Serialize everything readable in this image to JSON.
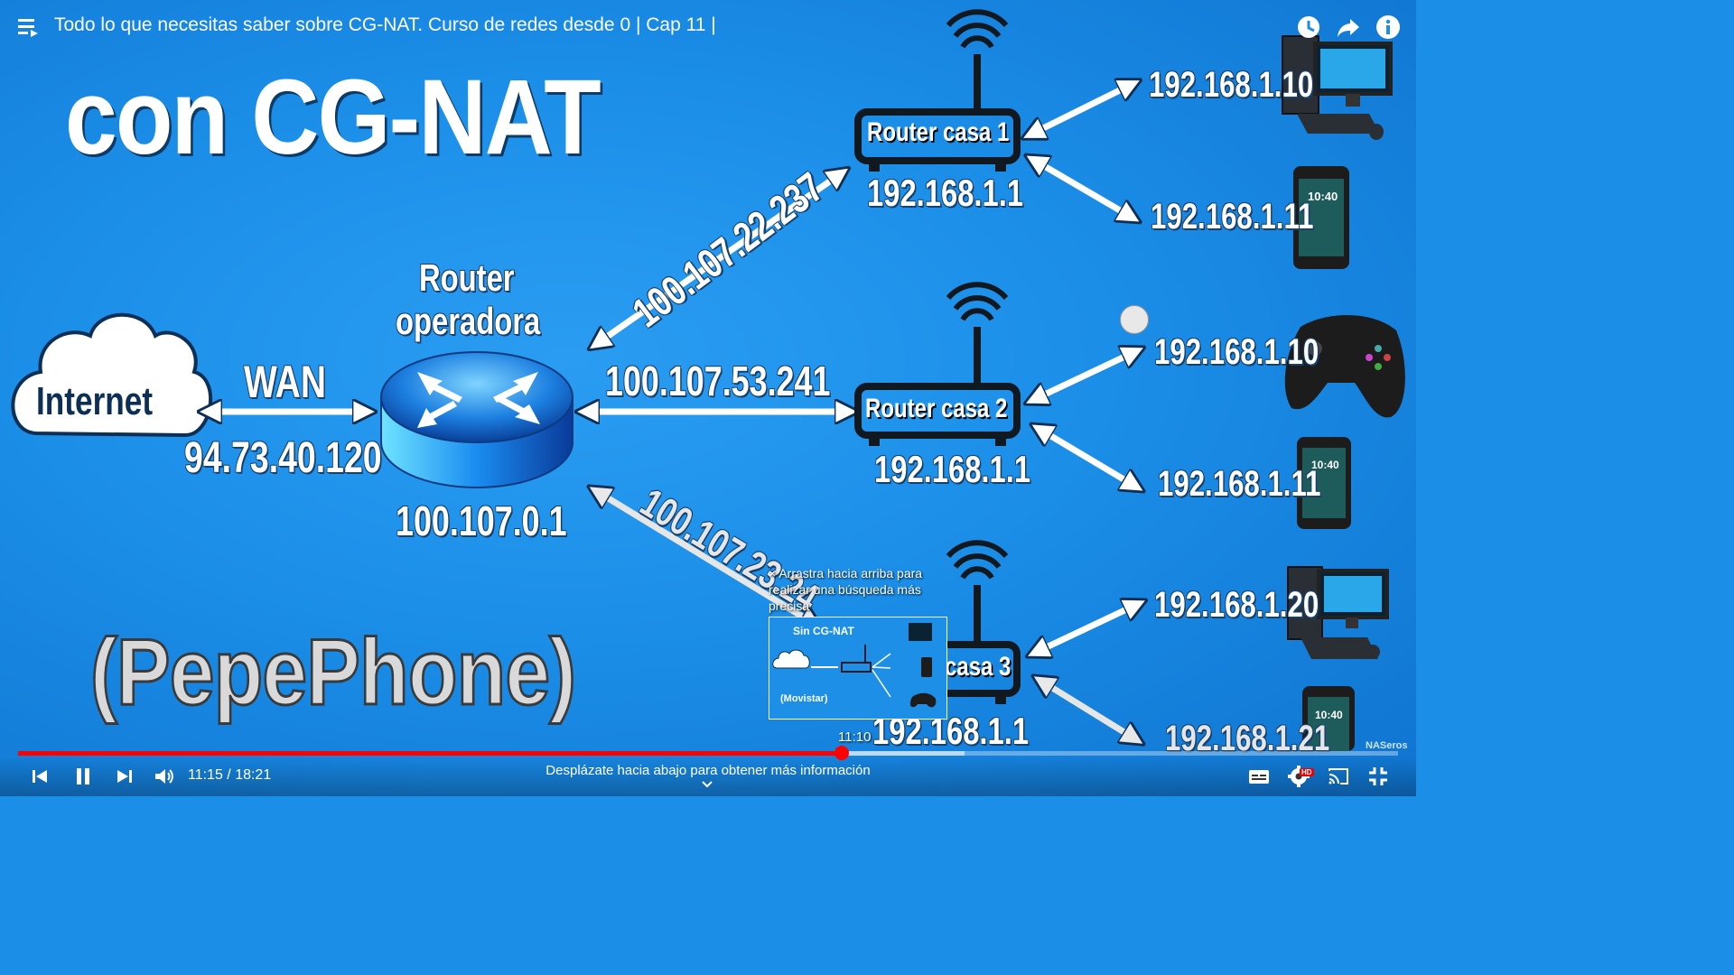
{
  "player": {
    "title": "Todo lo que necesitas saber sobre CG-NAT. Curso de redes desde 0 | Cap 11 |",
    "current_time": "11:15 / 18:21",
    "hover_time": "11:10",
    "progress_fraction": 0.597,
    "buffered_fraction": 0.686,
    "scroll_hint": "Desplázate hacia abajo para obtener más información",
    "hd_badge": "HD",
    "tooltip": "Arrastra hacia arriba para realizar una búsqueda más precisa",
    "tooltip_close": "×"
  },
  "video": {
    "heading": "con CG-NAT",
    "isp_name": "(PepePhone)",
    "internet_label": "Internet",
    "wan_label": "WAN",
    "wan_ip": "94.73.40.120",
    "isp_router_label_1": "Router",
    "isp_router_label_2": "operadora",
    "isp_router_ip": "100.107.0.1",
    "link_ip_1": "100.107.22.237",
    "link_ip_2": "100.107.53.241",
    "link_ip_3": "100.107.23.24",
    "routers": [
      {
        "label": "Router casa 1",
        "lan_ip": "192.168.1.1",
        "devices": [
          {
            "ip": "192.168.1.10",
            "icon": "desktop-pc"
          },
          {
            "ip": "192.168.1.11",
            "icon": "smartphone"
          }
        ]
      },
      {
        "label": "Router casa 2",
        "lan_ip": "192.168.1.1",
        "devices": [
          {
            "ip": "192.168.1.10",
            "icon": "gamepad"
          },
          {
            "ip": "192.168.1.11",
            "icon": "smartphone"
          }
        ]
      },
      {
        "label": "casa 3",
        "lan_ip": "192.168.1.1",
        "devices": [
          {
            "ip": "192.168.1.20",
            "icon": "desktop-pc"
          },
          {
            "ip": "192.168.1.21",
            "icon": "smartphone"
          }
        ]
      }
    ],
    "phone_clock": "10:40",
    "watermark": "NASeros"
  },
  "thumbnail": {
    "heading": "Sin CG-NAT",
    "isp_name": "(Movistar)"
  },
  "colors": {
    "background": "#1b8ee8",
    "progress": "#ff0000",
    "text": "#ffffff"
  }
}
